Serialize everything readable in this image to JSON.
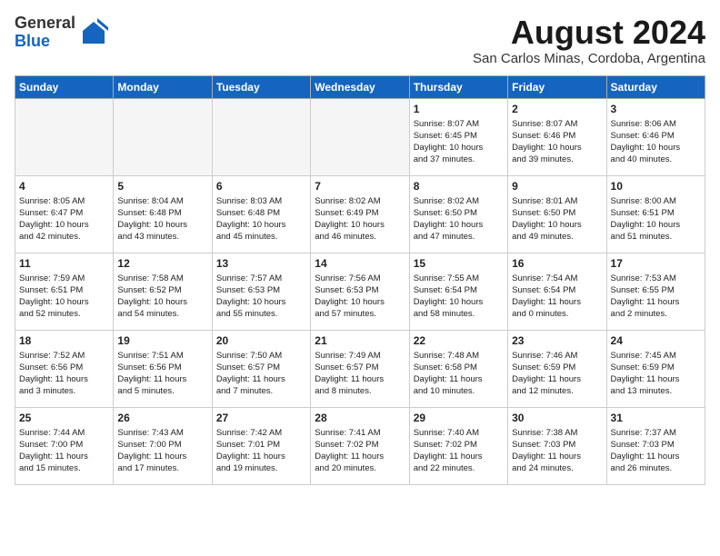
{
  "header": {
    "logo_general": "General",
    "logo_blue": "Blue",
    "month_year": "August 2024",
    "location": "San Carlos Minas, Cordoba, Argentina"
  },
  "calendar": {
    "weekdays": [
      "Sunday",
      "Monday",
      "Tuesday",
      "Wednesday",
      "Thursday",
      "Friday",
      "Saturday"
    ],
    "weeks": [
      [
        {
          "day": "",
          "info": "",
          "empty": true
        },
        {
          "day": "",
          "info": "",
          "empty": true
        },
        {
          "day": "",
          "info": "",
          "empty": true
        },
        {
          "day": "",
          "info": "",
          "empty": true
        },
        {
          "day": "1",
          "info": "Sunrise: 8:07 AM\nSunset: 6:45 PM\nDaylight: 10 hours\nand 37 minutes."
        },
        {
          "day": "2",
          "info": "Sunrise: 8:07 AM\nSunset: 6:46 PM\nDaylight: 10 hours\nand 39 minutes."
        },
        {
          "day": "3",
          "info": "Sunrise: 8:06 AM\nSunset: 6:46 PM\nDaylight: 10 hours\nand 40 minutes."
        }
      ],
      [
        {
          "day": "4",
          "info": "Sunrise: 8:05 AM\nSunset: 6:47 PM\nDaylight: 10 hours\nand 42 minutes."
        },
        {
          "day": "5",
          "info": "Sunrise: 8:04 AM\nSunset: 6:48 PM\nDaylight: 10 hours\nand 43 minutes."
        },
        {
          "day": "6",
          "info": "Sunrise: 8:03 AM\nSunset: 6:48 PM\nDaylight: 10 hours\nand 45 minutes."
        },
        {
          "day": "7",
          "info": "Sunrise: 8:02 AM\nSunset: 6:49 PM\nDaylight: 10 hours\nand 46 minutes."
        },
        {
          "day": "8",
          "info": "Sunrise: 8:02 AM\nSunset: 6:50 PM\nDaylight: 10 hours\nand 47 minutes."
        },
        {
          "day": "9",
          "info": "Sunrise: 8:01 AM\nSunset: 6:50 PM\nDaylight: 10 hours\nand 49 minutes."
        },
        {
          "day": "10",
          "info": "Sunrise: 8:00 AM\nSunset: 6:51 PM\nDaylight: 10 hours\nand 51 minutes."
        }
      ],
      [
        {
          "day": "11",
          "info": "Sunrise: 7:59 AM\nSunset: 6:51 PM\nDaylight: 10 hours\nand 52 minutes."
        },
        {
          "day": "12",
          "info": "Sunrise: 7:58 AM\nSunset: 6:52 PM\nDaylight: 10 hours\nand 54 minutes."
        },
        {
          "day": "13",
          "info": "Sunrise: 7:57 AM\nSunset: 6:53 PM\nDaylight: 10 hours\nand 55 minutes."
        },
        {
          "day": "14",
          "info": "Sunrise: 7:56 AM\nSunset: 6:53 PM\nDaylight: 10 hours\nand 57 minutes."
        },
        {
          "day": "15",
          "info": "Sunrise: 7:55 AM\nSunset: 6:54 PM\nDaylight: 10 hours\nand 58 minutes."
        },
        {
          "day": "16",
          "info": "Sunrise: 7:54 AM\nSunset: 6:54 PM\nDaylight: 11 hours\nand 0 minutes."
        },
        {
          "day": "17",
          "info": "Sunrise: 7:53 AM\nSunset: 6:55 PM\nDaylight: 11 hours\nand 2 minutes."
        }
      ],
      [
        {
          "day": "18",
          "info": "Sunrise: 7:52 AM\nSunset: 6:56 PM\nDaylight: 11 hours\nand 3 minutes."
        },
        {
          "day": "19",
          "info": "Sunrise: 7:51 AM\nSunset: 6:56 PM\nDaylight: 11 hours\nand 5 minutes."
        },
        {
          "day": "20",
          "info": "Sunrise: 7:50 AM\nSunset: 6:57 PM\nDaylight: 11 hours\nand 7 minutes."
        },
        {
          "day": "21",
          "info": "Sunrise: 7:49 AM\nSunset: 6:57 PM\nDaylight: 11 hours\nand 8 minutes."
        },
        {
          "day": "22",
          "info": "Sunrise: 7:48 AM\nSunset: 6:58 PM\nDaylight: 11 hours\nand 10 minutes."
        },
        {
          "day": "23",
          "info": "Sunrise: 7:46 AM\nSunset: 6:59 PM\nDaylight: 11 hours\nand 12 minutes."
        },
        {
          "day": "24",
          "info": "Sunrise: 7:45 AM\nSunset: 6:59 PM\nDaylight: 11 hours\nand 13 minutes."
        }
      ],
      [
        {
          "day": "25",
          "info": "Sunrise: 7:44 AM\nSunset: 7:00 PM\nDaylight: 11 hours\nand 15 minutes."
        },
        {
          "day": "26",
          "info": "Sunrise: 7:43 AM\nSunset: 7:00 PM\nDaylight: 11 hours\nand 17 minutes."
        },
        {
          "day": "27",
          "info": "Sunrise: 7:42 AM\nSunset: 7:01 PM\nDaylight: 11 hours\nand 19 minutes."
        },
        {
          "day": "28",
          "info": "Sunrise: 7:41 AM\nSunset: 7:02 PM\nDaylight: 11 hours\nand 20 minutes."
        },
        {
          "day": "29",
          "info": "Sunrise: 7:40 AM\nSunset: 7:02 PM\nDaylight: 11 hours\nand 22 minutes."
        },
        {
          "day": "30",
          "info": "Sunrise: 7:38 AM\nSunset: 7:03 PM\nDaylight: 11 hours\nand 24 minutes."
        },
        {
          "day": "31",
          "info": "Sunrise: 7:37 AM\nSunset: 7:03 PM\nDaylight: 11 hours\nand 26 minutes."
        }
      ]
    ]
  }
}
